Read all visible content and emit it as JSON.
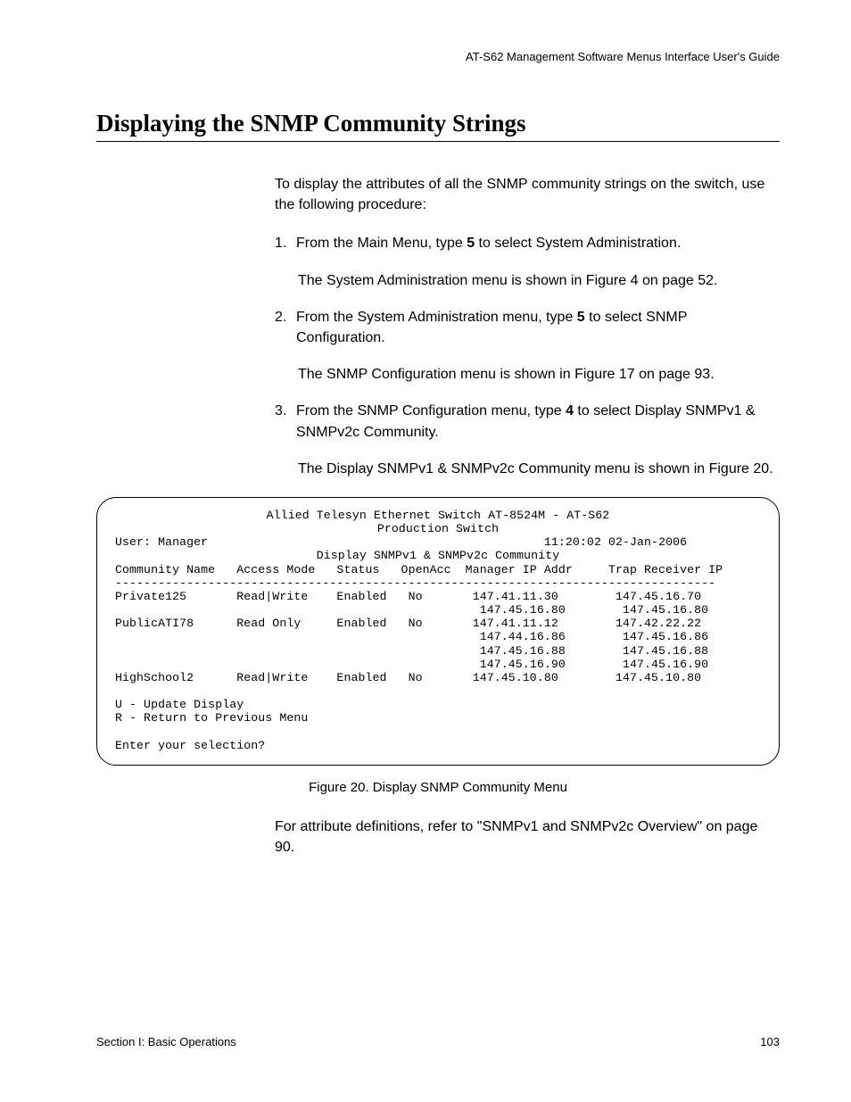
{
  "header": {
    "doc_title": "AT-S62 Management Software Menus Interface User's Guide"
  },
  "section": {
    "title": "Displaying the SNMP Community Strings",
    "intro": "To display the attributes of all the SNMP community strings on the switch, use the following procedure:",
    "steps": [
      {
        "num": "1.",
        "text_pre": "From the Main Menu, type ",
        "bold": "5",
        "text_post": " to select System Administration.",
        "followup": "The System Administration menu is shown in Figure 4 on page 52."
      },
      {
        "num": "2.",
        "text_pre": "From the System Administration menu, type ",
        "bold": "5",
        "text_post": " to select SNMP Configuration.",
        "followup": "The SNMP Configuration menu is shown in Figure 17 on page 93."
      },
      {
        "num": "3.",
        "text_pre": "From the SNMP Configuration menu, type ",
        "bold": "4",
        "text_post": " to select Display SNMPv1 & SNMPv2c Community.",
        "followup": "The Display SNMPv1 & SNMPv2c Community menu is shown in Figure 20."
      }
    ]
  },
  "menu": {
    "title1": "Allied Telesyn Ethernet Switch AT-8524M - AT-S62",
    "title2": "Production Switch",
    "user_label": "User: Manager",
    "timestamp": "11:20:02 02-Jan-2006",
    "subtitle": "Display SNMPv1 & SNMPv2c Community",
    "columns": "Community Name   Access Mode   Status   OpenAcc  Manager IP Addr     Trap Receiver IP",
    "divider": "------------------------------------------------------------------------------------",
    "rows": [
      "Private125       Read|Write    Enabled   No       147.41.11.30        147.45.16.70",
      "                                                   147.45.16.80        147.45.16.80",
      "PublicATI78      Read Only     Enabled   No       147.41.11.12        147.42.22.22",
      "                                                   147.44.16.86        147.45.16.86",
      "                                                   147.45.16.88        147.45.16.88",
      "                                                   147.45.16.90        147.45.16.90",
      "HighSchool2      Read|Write    Enabled   No       147.45.10.80        147.45.10.80"
    ],
    "option_u": "U - Update Display",
    "option_r": "R - Return to Previous Menu",
    "prompt": "Enter your selection?"
  },
  "figure_caption": "Figure 20. Display SNMP Community Menu",
  "closing_text": "For attribute definitions, refer to \"SNMPv1 and SNMPv2c Overview\" on page 90.",
  "footer": {
    "left": "Section I: Basic Operations",
    "right": "103"
  }
}
